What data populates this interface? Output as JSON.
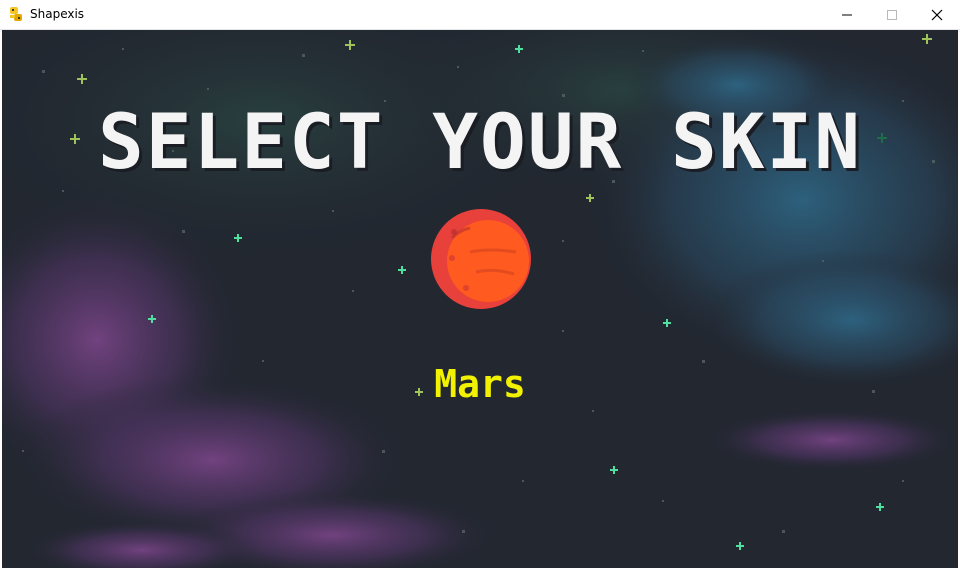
{
  "window": {
    "title": "Shapexis",
    "icon": "python-snake-icon",
    "controls": [
      "minimize-icon",
      "maximize-icon",
      "close-icon"
    ]
  },
  "screen": {
    "heading": "SELECT YOUR SKIN",
    "skin_name": "Mars",
    "skin_preview": "planet-icon"
  },
  "colors": {
    "background": "#222730",
    "heading": "#f4f4f4",
    "skin_name": "#f2f200",
    "planet_outer": "#e8413b",
    "planet_inner": "#ff5a1f",
    "nebula_purple": "#6f3d7a",
    "nebula_blue": "#2f5d78",
    "star_green": "#4fe0a0"
  }
}
